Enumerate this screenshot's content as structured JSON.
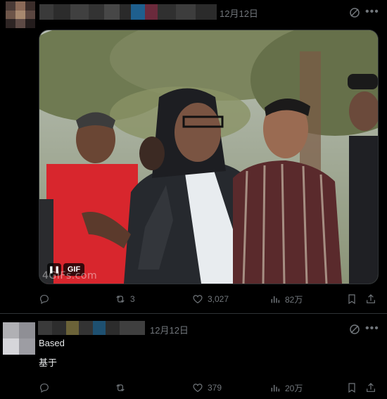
{
  "post": {
    "date": "12月12日",
    "media": {
      "badge": "GIF",
      "watermark": "4GIFs.com"
    },
    "actions": {
      "reposts": "3",
      "likes": "3,027",
      "views": "82万"
    }
  },
  "reply": {
    "date": "12月12日",
    "text_en": "Based",
    "text_zh": "基于",
    "actions": {
      "reposts": "",
      "likes": "379",
      "views": "20万"
    }
  },
  "colors": {
    "muted": "#71767b",
    "text": "#e7e9ea",
    "divider": "#2f3336",
    "bg": "#000000"
  }
}
